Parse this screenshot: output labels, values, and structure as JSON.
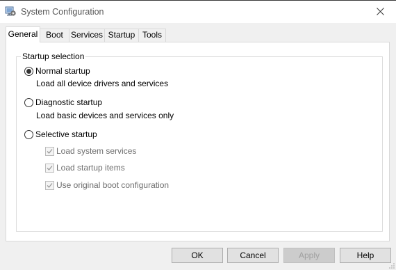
{
  "window": {
    "title": "System Configuration",
    "close_icon": "close-icon",
    "app_icon": "msconfig-icon"
  },
  "tabs": [
    {
      "label": "General",
      "active": true
    },
    {
      "label": "Boot",
      "active": false
    },
    {
      "label": "Services",
      "active": false
    },
    {
      "label": "Startup",
      "active": false
    },
    {
      "label": "Tools",
      "active": false
    }
  ],
  "general": {
    "group_label": "Startup selection",
    "options": [
      {
        "label": "Normal startup",
        "description": "Load all device drivers and services",
        "selected": true
      },
      {
        "label": "Diagnostic startup",
        "description": "Load basic devices and services only",
        "selected": false
      },
      {
        "label": "Selective startup",
        "description": "",
        "selected": false
      }
    ],
    "selective_items": [
      {
        "label": "Load system services",
        "checked": true,
        "enabled": false
      },
      {
        "label": "Load startup items",
        "checked": true,
        "enabled": false
      },
      {
        "label": "Use original boot configuration",
        "checked": true,
        "enabled": false
      }
    ]
  },
  "buttons": {
    "ok": "OK",
    "cancel": "Cancel",
    "apply": "Apply",
    "help": "Help"
  }
}
